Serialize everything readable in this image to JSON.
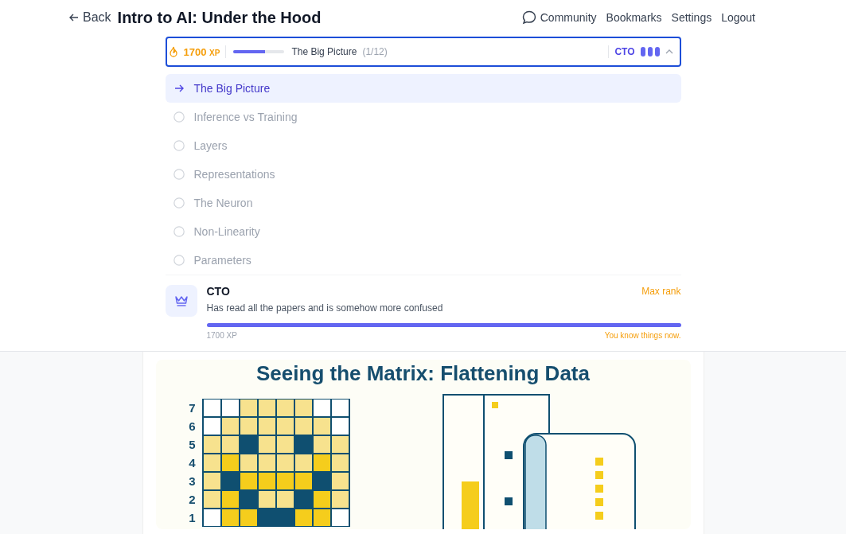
{
  "header": {
    "back": "Back",
    "title": "Intro to AI: Under the Hood",
    "nav": [
      {
        "label": "Community",
        "kind": "chat"
      },
      {
        "label": "Bookmarks",
        "kind": "plain"
      },
      {
        "label": "Settings",
        "kind": "plain"
      },
      {
        "label": "Logout",
        "kind": "plain"
      }
    ]
  },
  "progress_bar": {
    "xp": "1700",
    "xp_unit": "XP",
    "level": 0.62,
    "lesson": "The Big Picture",
    "count": "(1/12)",
    "rank": "CTO",
    "expanded": true
  },
  "lessons": [
    {
      "label": "The Big Picture",
      "selected": true
    },
    {
      "label": "Inference vs Training",
      "selected": false
    },
    {
      "label": "Layers",
      "selected": false
    },
    {
      "label": "Representations",
      "selected": false
    },
    {
      "label": "The Neuron",
      "selected": false
    },
    {
      "label": "Non-Linearity",
      "selected": false
    },
    {
      "label": "Parameters",
      "selected": false
    }
  ],
  "rank_card": {
    "title": "CTO",
    "status": "Max rank",
    "description": "Has read all the papers and is somehow more confused",
    "level": 1,
    "xp": "1700 XP",
    "message": "You know things now."
  },
  "figure": {
    "title": "Seeing the Matrix: Flattening Data",
    "grid": [
      {
        "label": "7",
        "cells": [
          {
            "color": "#ffffff"
          },
          {
            "color": "#ffffff"
          },
          {
            "color": "#f7e28e"
          },
          {
            "color": "#f7e28e"
          },
          {
            "color": "#f7e28e"
          },
          {
            "color": "#f7e28e"
          },
          {
            "color": "#ffffff"
          },
          {
            "color": "#ffffff"
          }
        ]
      },
      {
        "label": "6",
        "cells": [
          {
            "color": "#ffffff"
          },
          {
            "color": "#f7e28e"
          },
          {
            "color": "#f7e28e"
          },
          {
            "color": "#f7e28e"
          },
          {
            "color": "#f7e28e"
          },
          {
            "color": "#f7e28e"
          },
          {
            "color": "#f7e28e"
          },
          {
            "color": "#ffffff"
          }
        ]
      },
      {
        "label": "5",
        "cells": [
          {
            "color": "#f7e28e"
          },
          {
            "color": "#f7e28e"
          },
          {
            "color": "#0f4f70"
          },
          {
            "color": "#f7e28e"
          },
          {
            "color": "#f7e28e"
          },
          {
            "color": "#0f4f70"
          },
          {
            "color": "#f7e28e"
          },
          {
            "color": "#f7e28e"
          }
        ]
      },
      {
        "label": "4",
        "cells": [
          {
            "color": "#f7e28e"
          },
          {
            "color": "#f5cd1c"
          },
          {
            "color": "#f7e28e"
          },
          {
            "color": "#f7e28e"
          },
          {
            "color": "#f7e28e"
          },
          {
            "color": "#f7e28e"
          },
          {
            "color": "#f5cd1c"
          },
          {
            "color": "#f7e28e"
          }
        ]
      },
      {
        "label": "3",
        "cells": [
          {
            "color": "#f7e28e"
          },
          {
            "color": "#0f4f70"
          },
          {
            "color": "#f5cd1c"
          },
          {
            "color": "#f5cd1c"
          },
          {
            "color": "#f5cd1c"
          },
          {
            "color": "#f5cd1c"
          },
          {
            "color": "#0f4f70"
          },
          {
            "color": "#f7e28e"
          }
        ]
      },
      {
        "label": "2",
        "cells": [
          {
            "color": "#f7e28e"
          },
          {
            "color": "#f5cd1c"
          },
          {
            "color": "#0f4f70"
          },
          {
            "color": "#f7e28e"
          },
          {
            "color": "#f7e28e"
          },
          {
            "color": "#0f4f70"
          },
          {
            "color": "#f5cd1c"
          },
          {
            "color": "#f7e28e"
          }
        ]
      },
      {
        "label": "1",
        "cells": [
          {
            "color": "#ffffff"
          },
          {
            "color": "#f5cd1c"
          },
          {
            "color": "#f5cd1c"
          },
          {
            "color": "#0f4f70"
          },
          {
            "color": "#0f4f70"
          },
          {
            "color": "#f5cd1c"
          },
          {
            "color": "#f5cd1c"
          },
          {
            "color": "#ffffff"
          }
        ]
      }
    ]
  }
}
